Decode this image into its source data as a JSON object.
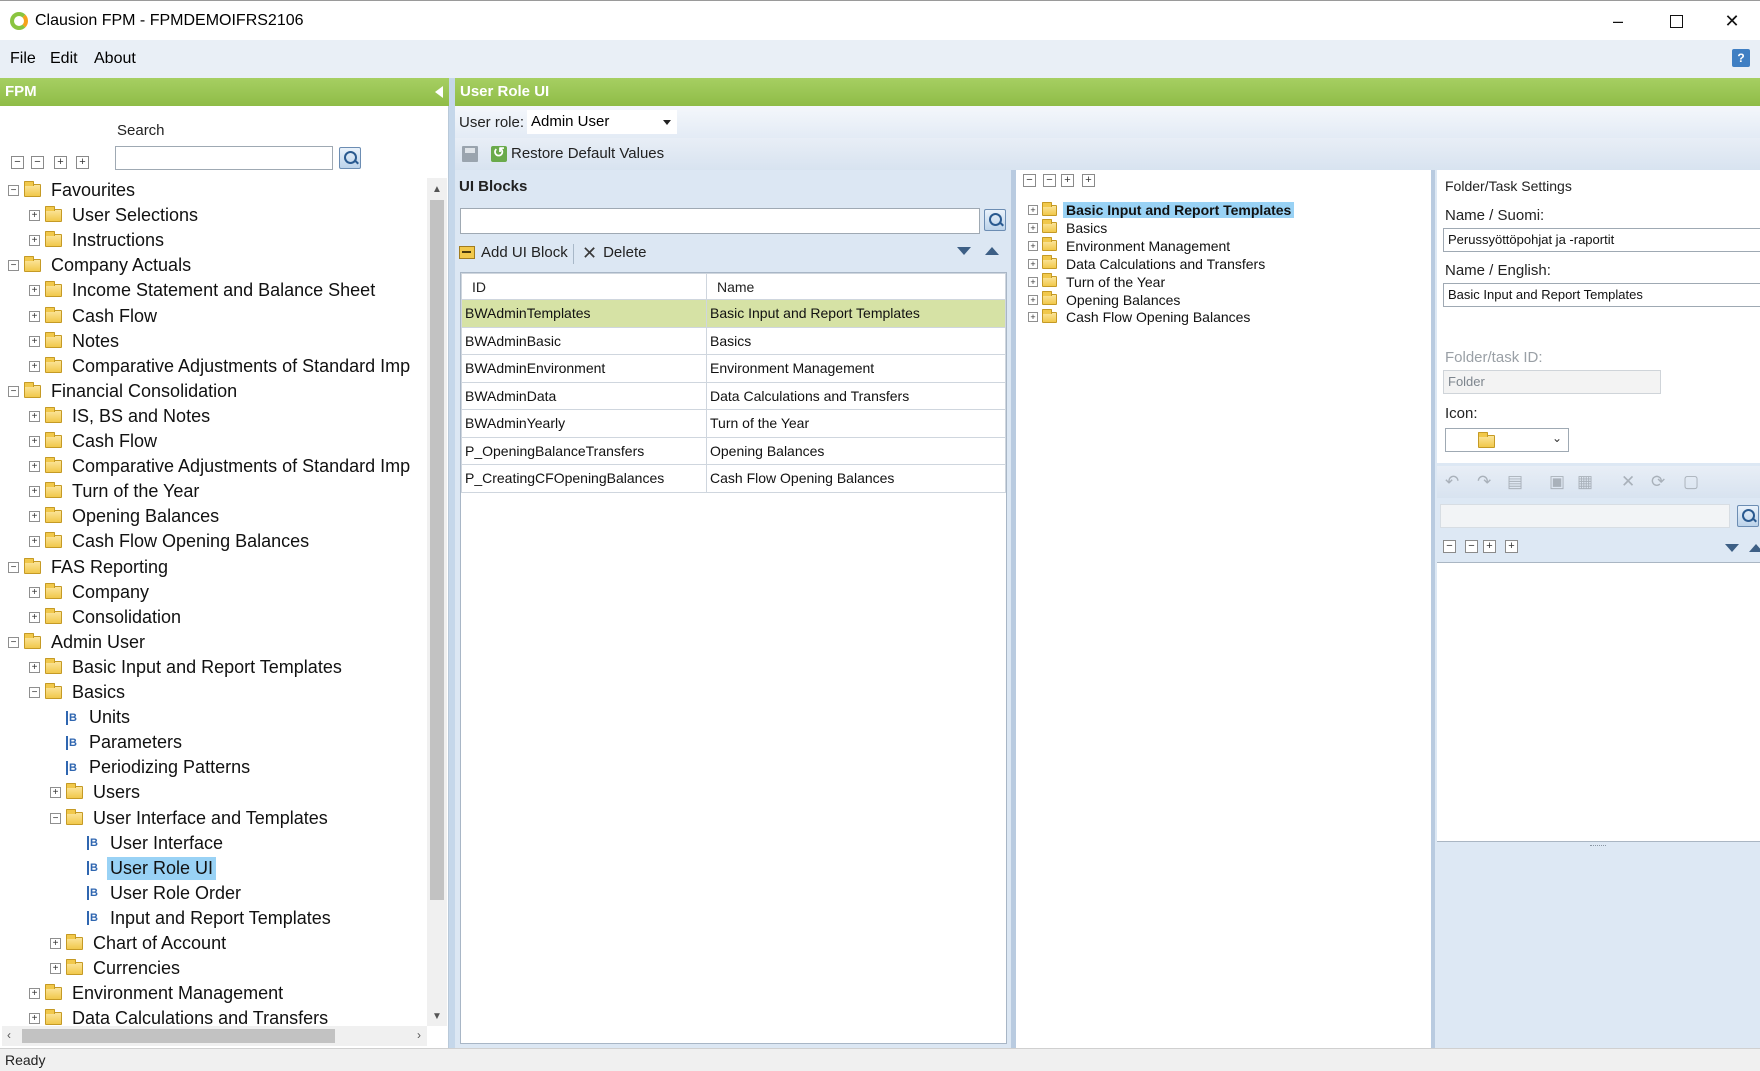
{
  "window": {
    "title": "Clausion FPM - FPMDEMOIFRS2106",
    "minimize": "–",
    "close": "✕"
  },
  "menu": [
    "File",
    "Edit",
    "About"
  ],
  "help_label": "?",
  "left_panel": {
    "header": "FPM",
    "search_label": "Search",
    "search_value": "",
    "tree": [
      {
        "label": "Favourites",
        "level": 0,
        "kind": "folder",
        "expander": "−"
      },
      {
        "label": "User Selections",
        "level": 1,
        "kind": "folder",
        "expander": "+"
      },
      {
        "label": "Instructions",
        "level": 1,
        "kind": "folder",
        "expander": "+"
      },
      {
        "label": "Company Actuals",
        "level": 0,
        "kind": "folder",
        "expander": "−"
      },
      {
        "label": "Income Statement and Balance Sheet",
        "level": 1,
        "kind": "folder",
        "expander": "+"
      },
      {
        "label": "Cash Flow",
        "level": 1,
        "kind": "folder",
        "expander": "+"
      },
      {
        "label": "Notes",
        "level": 1,
        "kind": "folder",
        "expander": "+"
      },
      {
        "label": "Comparative Adjustments of Standard Imp",
        "level": 1,
        "kind": "folder",
        "expander": "+"
      },
      {
        "label": "Financial Consolidation",
        "level": 0,
        "kind": "folder",
        "expander": "−"
      },
      {
        "label": "IS, BS and Notes",
        "level": 1,
        "kind": "folder",
        "expander": "+"
      },
      {
        "label": "Cash Flow",
        "level": 1,
        "kind": "folder",
        "expander": "+"
      },
      {
        "label": "Comparative Adjustments of Standard Imp",
        "level": 1,
        "kind": "folder",
        "expander": "+"
      },
      {
        "label": "Turn of the Year",
        "level": 1,
        "kind": "folder",
        "expander": "+"
      },
      {
        "label": "Opening Balances",
        "level": 1,
        "kind": "folder",
        "expander": "+"
      },
      {
        "label": "Cash Flow Opening Balances",
        "level": 1,
        "kind": "folder",
        "expander": "+"
      },
      {
        "label": "FAS Reporting",
        "level": 0,
        "kind": "folder",
        "expander": "−"
      },
      {
        "label": "Company",
        "level": 1,
        "kind": "folder",
        "expander": "+"
      },
      {
        "label": "Consolidation",
        "level": 1,
        "kind": "folder",
        "expander": "+"
      },
      {
        "label": "Admin User",
        "level": 0,
        "kind": "folder",
        "expander": "−"
      },
      {
        "label": "Basic Input and Report Templates",
        "level": 1,
        "kind": "folder",
        "expander": "+"
      },
      {
        "label": "Basics",
        "level": 1,
        "kind": "folder",
        "expander": "−"
      },
      {
        "label": "Units",
        "level": 2,
        "kind": "block",
        "expander": ""
      },
      {
        "label": "Parameters",
        "level": 2,
        "kind": "block",
        "expander": ""
      },
      {
        "label": "Periodizing Patterns",
        "level": 2,
        "kind": "block",
        "expander": ""
      },
      {
        "label": "Users",
        "level": 2,
        "kind": "folder",
        "expander": "+"
      },
      {
        "label": "User Interface and Templates",
        "level": 2,
        "kind": "folder",
        "expander": "−"
      },
      {
        "label": "User Interface",
        "level": 3,
        "kind": "block",
        "expander": ""
      },
      {
        "label": "User Role UI",
        "level": 3,
        "kind": "block",
        "expander": "",
        "selected": true
      },
      {
        "label": "User Role Order",
        "level": 3,
        "kind": "block",
        "expander": ""
      },
      {
        "label": "Input and Report Templates",
        "level": 3,
        "kind": "block",
        "expander": ""
      },
      {
        "label": "Chart of Account",
        "level": 2,
        "kind": "folder",
        "expander": "+"
      },
      {
        "label": "Currencies",
        "level": 2,
        "kind": "folder",
        "expander": "+"
      },
      {
        "label": "Environment Management",
        "level": 1,
        "kind": "folder",
        "expander": "+"
      },
      {
        "label": "Data Calculations and Transfers",
        "level": 1,
        "kind": "folder",
        "expander": "+"
      }
    ]
  },
  "main": {
    "header": "User Role UI",
    "user_role_label": "User role:",
    "user_role_value": "Admin User",
    "restore_label": "Restore Default Values",
    "blocks": {
      "title": "UI Blocks",
      "search_value": "",
      "add_label": "Add UI Block",
      "delete_label": "Delete",
      "columns": [
        "ID",
        "Name"
      ],
      "rows": [
        {
          "id": "BWAdminTemplates",
          "name": "Basic Input and Report Templates",
          "selected": true
        },
        {
          "id": "BWAdminBasic",
          "name": "Basics"
        },
        {
          "id": "BWAdminEnvironment",
          "name": "Environment Management"
        },
        {
          "id": "BWAdminData",
          "name": "Data Calculations and Transfers"
        },
        {
          "id": "BWAdminYearly",
          "name": "Turn of the Year"
        },
        {
          "id": "P_OpeningBalanceTransfers",
          "name": "Opening Balances"
        },
        {
          "id": "P_CreatingCFOpeningBalances",
          "name": "Cash Flow Opening Balances"
        }
      ]
    },
    "tree": [
      {
        "label": "Basic Input and Report Templates",
        "selected": true
      },
      {
        "label": "Basics"
      },
      {
        "label": "Environment Management"
      },
      {
        "label": "Data Calculations and Transfers"
      },
      {
        "label": "Turn of the Year"
      },
      {
        "label": "Opening Balances"
      },
      {
        "label": "Cash Flow Opening Balances"
      }
    ],
    "settings": {
      "title": "Folder/Task Settings",
      "name_fi_label": "Name / Suomi:",
      "name_fi_value": "Perussyöttöpohjat ja -raportit",
      "name_en_label": "Name / English:",
      "name_en_value": "Basic Input and Report Templates",
      "id_label": "Folder/task ID:",
      "id_value": "Folder",
      "icon_label": "Icon:",
      "icon_name": "folder-icon"
    }
  },
  "status": "Ready",
  "colors": {
    "header_green": "#8fbc47",
    "selection_blue": "#99d2f5",
    "selected_row": "#d6e2a5"
  }
}
